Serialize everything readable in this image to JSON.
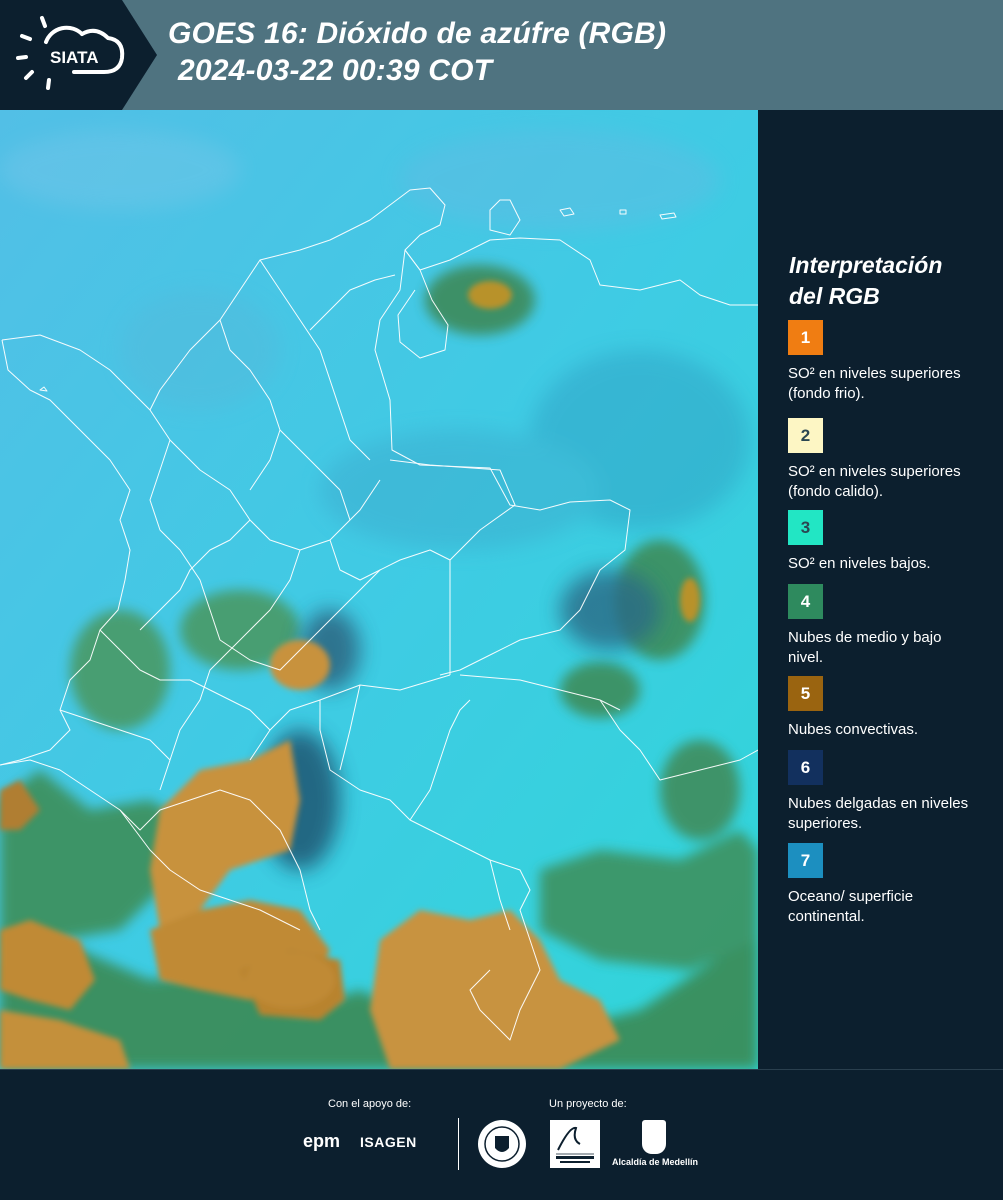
{
  "header": {
    "logo_text": "SIATA",
    "title_line_1": "GOES 16: Dióxido de azúfre (RGB)",
    "title_line_2": "2024-03-22 00:39 COT"
  },
  "legend": {
    "title_line_1": "Interpretación",
    "title_line_2": "del RGB",
    "items": [
      {
        "number": "1",
        "label": "SO² en niveles superiores (fondo frio).",
        "color": "#f07d12",
        "text_color": "#ffffff"
      },
      {
        "number": "2",
        "label": "SO² en niveles superiores (fondo calido).",
        "color": "#fdf6c4",
        "text_color": "#2b4752"
      },
      {
        "number": "3",
        "label": "SO² en niveles bajos.",
        "color": "#22e6c4",
        "text_color": "#2b4752"
      },
      {
        "number": "4",
        "label": "Nubes de medio y bajo nivel.",
        "color": "#2e8a5e",
        "text_color": "#ffffff"
      },
      {
        "number": "5",
        "label": "Nubes convectivas.",
        "color": "#9a6410",
        "text_color": "#ffffff"
      },
      {
        "number": "6",
        "label": "Nubes delgadas en niveles superiores.",
        "color": "#12305e",
        "text_color": "#ffffff"
      },
      {
        "number": "7",
        "label": "Oceano/ superficie continental.",
        "color": "#1c8fc0",
        "text_color": "#ffffff"
      }
    ]
  },
  "footer": {
    "support_caption": "Con el apoyo de:",
    "project_caption": "Un proyecto de:",
    "epm_logo": "epm",
    "isagen_logo": "ISAGEN",
    "area_logo": "Área METROPOLITANA Valle de Aburrá",
    "alcaldia_logo": "Alcaldía de Medellín"
  },
  "map_colors": {
    "ocean": "#3ec8e6",
    "land_cyan": "#35d2dc",
    "convective": "#c6923a",
    "green_clouds": "#3f8f58",
    "thin_high": "#2a5f7a",
    "borders": "#ffffff"
  }
}
